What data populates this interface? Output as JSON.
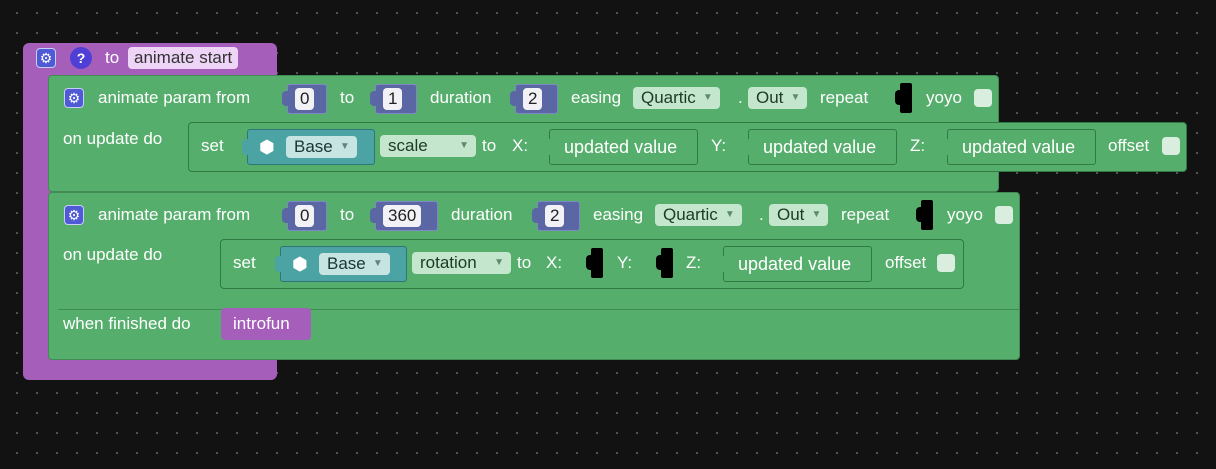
{
  "procedure": {
    "to_label": "to",
    "name": "animate start",
    "help_glyph": "?",
    "icons": [
      "gear-icon",
      "help-icon"
    ]
  },
  "animate1": {
    "label": "animate param from",
    "from": "0",
    "to_label": "to",
    "to": "1",
    "duration_label": "duration",
    "duration": "2",
    "easing_label": "easing",
    "easing": "Quartic",
    "dot": ".",
    "easing_mode": "Out",
    "repeat_label": "repeat",
    "yoyo_label": "yoyo",
    "on_update_label": "on update do",
    "set": {
      "set_label": "set",
      "object": "Base",
      "property": "scale",
      "to_label": "to",
      "x_label": "X:",
      "x_value": "updated value",
      "y_label": "Y:",
      "y_value": "updated value",
      "z_label": "Z:",
      "z_value": "updated value",
      "offset_label": "offset"
    }
  },
  "animate2": {
    "label": "animate param from",
    "from": "0",
    "to_label": "to",
    "to": "360",
    "duration_label": "duration",
    "duration": "2",
    "easing_label": "easing",
    "easing": "Quartic",
    "dot": ".",
    "easing_mode": "Out",
    "repeat_label": "repeat",
    "yoyo_label": "yoyo",
    "on_update_label": "on update do",
    "set": {
      "set_label": "set",
      "object": "Base",
      "property": "rotation",
      "to_label": "to",
      "x_label": "X:",
      "y_label": "Y:",
      "z_label": "Z:",
      "z_value": "updated value",
      "offset_label": "offset"
    },
    "when_finished_label": "when finished do",
    "call": "introfun"
  },
  "colors": {
    "procedure": "#a55fba",
    "animate": "#55ae6c",
    "number": "#5b67a5",
    "object": "#4ba3a3",
    "background": "#121212"
  }
}
